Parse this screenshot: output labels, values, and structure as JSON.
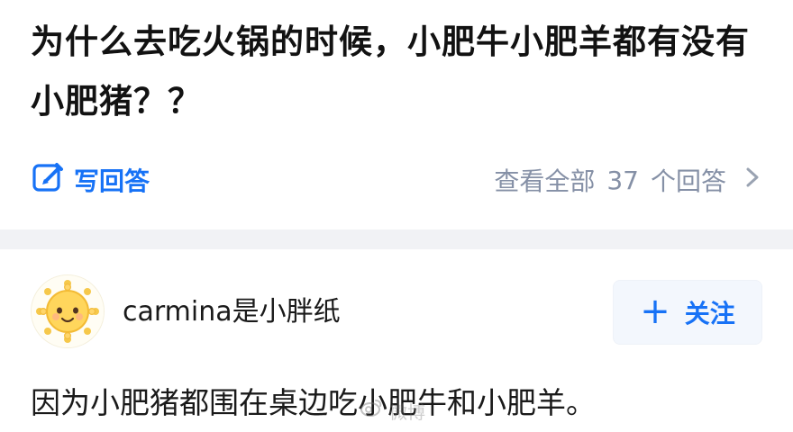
{
  "question": {
    "title": "为什么去吃火锅的时候，小肥牛小肥羊都有没有小肥猪？？",
    "write_answer_label": "写回答",
    "view_all_prefix": "查看全部",
    "answer_count": "37",
    "view_all_suffix": "个回答"
  },
  "answer": {
    "author_name": "carmina是小胖纸",
    "follow_label": "关注",
    "text": "因为小肥猪都围在桌边吃小肥牛和小肥羊。"
  },
  "overlay": {
    "watermark": "微博"
  },
  "colors": {
    "accent_blue": "#1772f6",
    "muted_gray": "#8590a6",
    "band_gray": "#f1f2f5",
    "follow_bg": "#f3f7fd"
  },
  "icons": {
    "write_answer": "edit-icon",
    "view_all": "chevron-right-icon",
    "avatar": "sun-face-avatar",
    "follow": "plus-icon",
    "watermark": "weibo-icon"
  }
}
